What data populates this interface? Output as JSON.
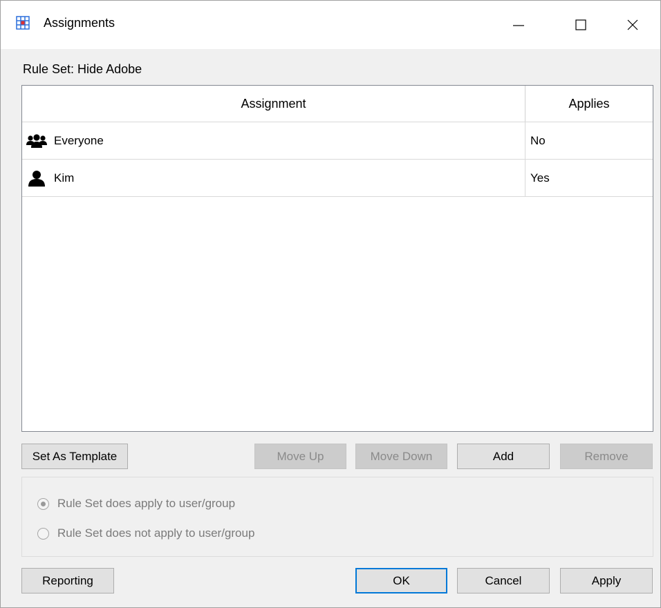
{
  "window": {
    "title": "Assignments",
    "icon": "grid-app-icon",
    "controls": [
      "minimize-icon",
      "maximize-icon",
      "close-icon"
    ]
  },
  "rule_set_label": "Rule Set: Hide Adobe",
  "table": {
    "columns": [
      "Assignment",
      "Applies"
    ],
    "rows": [
      {
        "icon": "group-icon",
        "assignment": "Everyone",
        "applies": "No"
      },
      {
        "icon": "user-icon",
        "assignment": "Kim",
        "applies": "Yes"
      }
    ]
  },
  "actions": {
    "set_as_template": "Set As Template",
    "move_up": "Move Up",
    "move_down": "Move Down",
    "add": "Add",
    "remove": "Remove"
  },
  "radio_options": {
    "applies": "Rule Set does apply to user/group",
    "not_applies": "Rule Set does not apply to user/group",
    "selected": "applies",
    "disabled": true
  },
  "footer": {
    "reporting": "Reporting",
    "ok": "OK",
    "cancel": "Cancel",
    "apply": "Apply"
  },
  "colors": {
    "accent": "#0078d7",
    "app_icon_blue": "#2a6fdb",
    "app_icon_red": "#e03030"
  }
}
